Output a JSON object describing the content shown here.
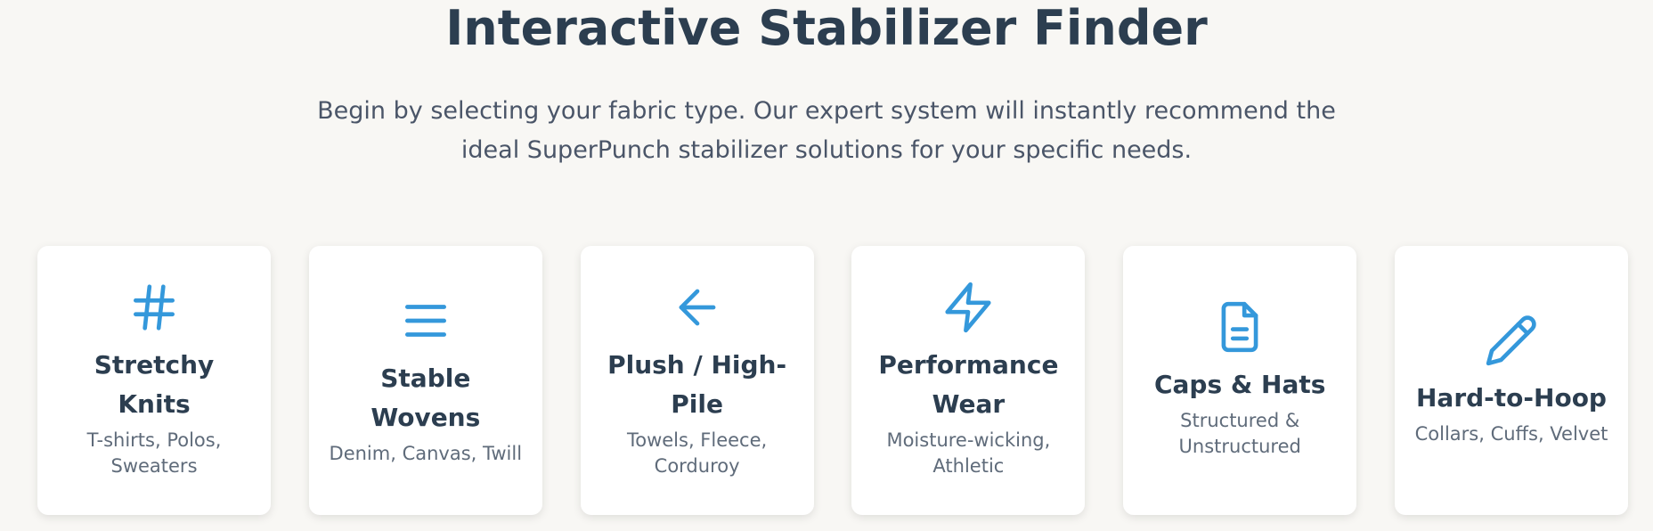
{
  "header": {
    "title": "Interactive Stabilizer Finder",
    "subtitle": "Begin by selecting your fabric type. Our expert system will instantly recommend the ideal SuperPunch stabilizer solutions for your specific needs."
  },
  "colors": {
    "accent": "#3498db",
    "heading": "#2c3e50",
    "background": "#f8f7f4"
  },
  "fabric_types": [
    {
      "icon": "hashtag-icon",
      "title": "Stretchy Knits",
      "description": "T-shirts, Polos, Sweaters"
    },
    {
      "icon": "lines-icon",
      "title": "Stable Wovens",
      "description": "Denim, Canvas, Twill"
    },
    {
      "icon": "arrow-left-icon",
      "title": "Plush / High-Pile",
      "description": "Towels, Fleece, Corduroy"
    },
    {
      "icon": "lightning-icon",
      "title": "Performance Wear",
      "description": "Moisture-wicking, Athletic"
    },
    {
      "icon": "document-icon",
      "title": "Caps & Hats",
      "description": "Structured & Unstructured"
    },
    {
      "icon": "pencil-icon",
      "title": "Hard-to-Hoop",
      "description": "Collars, Cuffs, Velvet"
    }
  ]
}
